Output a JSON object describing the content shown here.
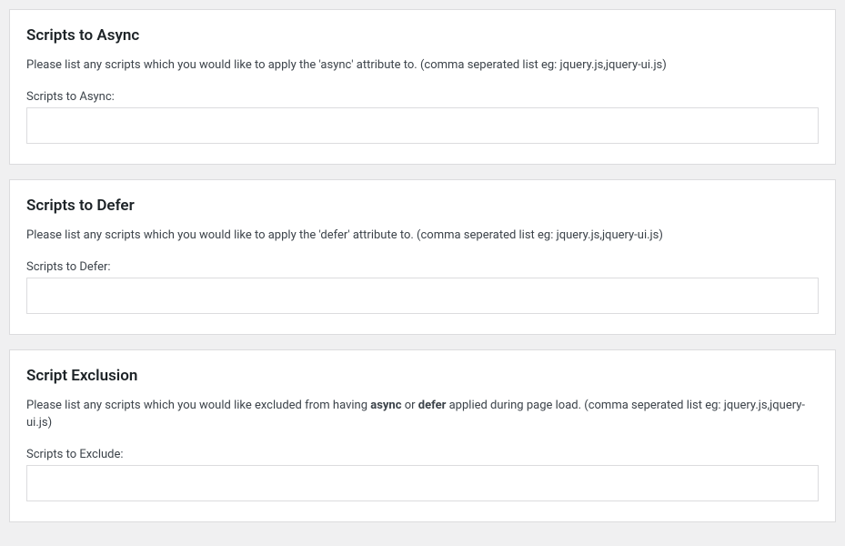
{
  "sections": {
    "async": {
      "title": "Scripts to Async",
      "description_pre": "Please list any scripts which you would like to apply the 'async' attribute to. (comma seperated list eg: jquery.js,jquery-ui.js)",
      "label": "Scripts to Async:",
      "value": ""
    },
    "defer": {
      "title": "Scripts to Defer",
      "description_pre": "Please list any scripts which you would like to apply the 'defer' attribute to. (comma seperated list eg: jquery.js,jquery-ui.js)",
      "label": "Scripts to Defer:",
      "value": ""
    },
    "exclude": {
      "title": "Script Exclusion",
      "description_pre": "Please list any scripts which you would like excluded from having ",
      "description_bold1": "async",
      "description_mid": " or ",
      "description_bold2": "defer",
      "description_post": " applied during page load. (comma seperated list eg: jquery.js,jquery-ui.js)",
      "label": "Scripts to Exclude:",
      "value": ""
    }
  }
}
